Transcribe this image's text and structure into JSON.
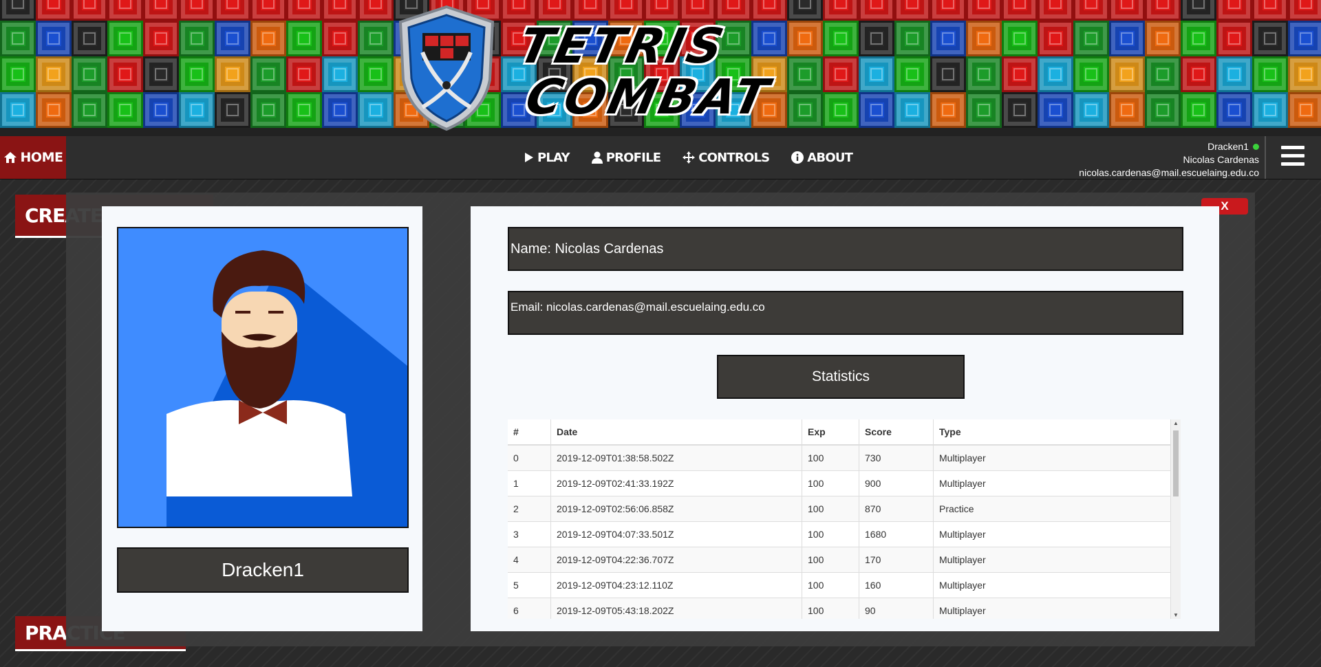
{
  "logo": {
    "line1": "TETRIS",
    "line2": "COMBAT"
  },
  "nav": {
    "home_label": "HOME",
    "items": [
      {
        "label": "PLAY",
        "icon": "play-icon"
      },
      {
        "label": "PROFILE",
        "icon": "user-icon"
      },
      {
        "label": "CONTROLS",
        "icon": "controls-icon"
      },
      {
        "label": "ABOUT",
        "icon": "info-icon"
      }
    ]
  },
  "user": {
    "username": "Dracken1",
    "full_name": "Nicolas Cardenas",
    "email": "nicolas.cardenas@mail.escuelaing.edu.co",
    "status_color": "#3bd23b"
  },
  "background": {
    "create_tab": "CREATE",
    "practice_tab": "PRACTICE"
  },
  "modal": {
    "close_label": "X",
    "username": "Dracken1",
    "name_field": "Name: Nicolas Cardenas",
    "email_field": "Email: nicolas.cardenas@mail.escuelaing.edu.co",
    "statistics_label": "Statistics",
    "table": {
      "columns": [
        "#",
        "Date",
        "Exp",
        "Score",
        "Type"
      ],
      "rows": [
        [
          "0",
          "2019-12-09T01:38:58.502Z",
          "100",
          "730",
          "Multiplayer"
        ],
        [
          "1",
          "2019-12-09T02:41:33.192Z",
          "100",
          "900",
          "Multiplayer"
        ],
        [
          "2",
          "2019-12-09T02:56:06.858Z",
          "100",
          "870",
          "Practice"
        ],
        [
          "3",
          "2019-12-09T04:07:33.501Z",
          "100",
          "1680",
          "Multiplayer"
        ],
        [
          "4",
          "2019-12-09T04:22:36.707Z",
          "100",
          "170",
          "Multiplayer"
        ],
        [
          "5",
          "2019-12-09T04:23:12.110Z",
          "100",
          "160",
          "Multiplayer"
        ],
        [
          "6",
          "2019-12-09T05:43:18.202Z",
          "100",
          "90",
          "Multiplayer"
        ]
      ]
    }
  },
  "colors": {
    "accent_red": "#8a1414",
    "close_red": "#c9191d",
    "field_bg": "#3d3b38",
    "avatar_bg": "#3f8cff"
  }
}
